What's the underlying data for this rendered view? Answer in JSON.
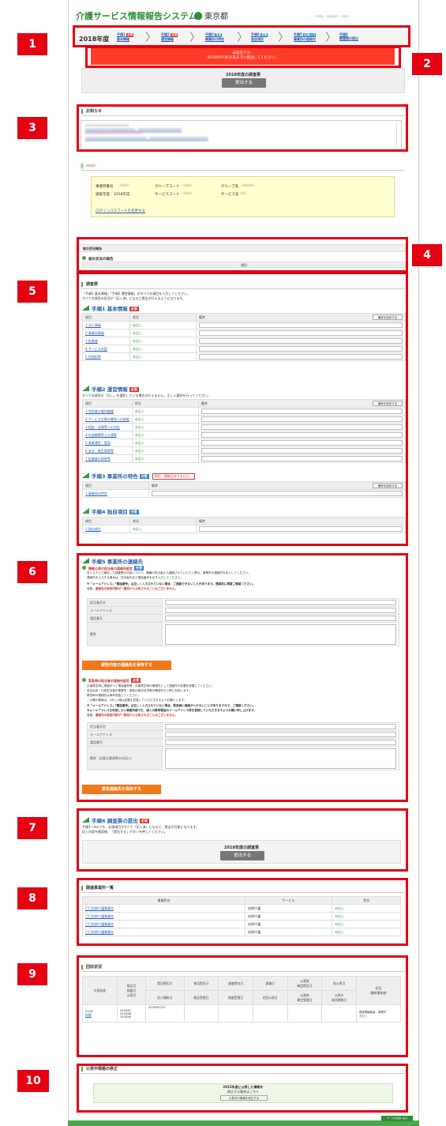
{
  "header": {
    "title": "介護サービス情報報告システム",
    "tokyo": "東京都"
  },
  "steps": {
    "year": "2018年度",
    "items": [
      {
        "line1": "手順1",
        "badge": "必須",
        "line2": "基本情報"
      },
      {
        "line1": "手順2",
        "badge": "必須",
        "line2": "運営情報"
      },
      {
        "line1": "手順3",
        "badge": "任意",
        "line2": "事業所の特色"
      },
      {
        "line1": "手順4",
        "badge": "任意",
        "line2": "独自項目"
      },
      {
        "line1": "手順5",
        "badge": "必須入力",
        "line2": "事業所の連絡先"
      },
      {
        "line1": "手順6",
        "badge": "",
        "line2": "調査票の提出"
      }
    ]
  },
  "alert": {
    "line1": "未提出です。",
    "line2": "2018年07月31日までに提出してください。"
  },
  "submit_top": {
    "title": "2018年度の調査票",
    "button": "提出する"
  },
  "notice": {
    "heading": "お知らせ"
  },
  "office_info": {
    "row1": [
      "事業所番号",
      "グループコード",
      "グループ名"
    ],
    "row2": [
      "調査年度：",
      "2018年度",
      "サービスコード",
      "サービス名"
    ],
    "password_link": "ログインパスワードを変更する"
  },
  "disaster": {
    "bar_label": "被災状況報告",
    "subheading": "被災状況の報告",
    "col_header": "項目",
    "link": "被災状況の報告"
  },
  "survey": {
    "heading": "調査票",
    "intro1": "「手順1 基本情報」「手順2 運営情報」のすべての項目を入力してください。",
    "intro2": "すべての項目の状況が「記入済」になると提出が行えるようになります。",
    "col_item": "項目",
    "col_status": "状況",
    "col_note": "備考",
    "save_note_btn": "備考を保存する",
    "step1": {
      "title": "手順1 基本情報",
      "badge": "必須",
      "rows": [
        {
          "item": "1.法人情報",
          "status": "未記入"
        },
        {
          "item": "2.事業所情報",
          "status": "未記入"
        },
        {
          "item": "3.従業者",
          "status": "未記入"
        },
        {
          "item": "4.サービス内容",
          "status": "未記入"
        },
        {
          "item": "5.利用料等",
          "status": "未記入"
        }
      ]
    },
    "step2": {
      "title": "手順2 運営情報",
      "badge": "必須",
      "intro": "すべての項目の「なし」を選択している場合は行えません。正しい選択を行ってください。",
      "rows": [
        {
          "item": "1.利用者の権利擁護",
          "status": "未記入"
        },
        {
          "item": "2.サービスの質の確保への取組",
          "status": "未記入"
        },
        {
          "item": "3.相談・苦情等への対応",
          "status": "未記入"
        },
        {
          "item": "4.外部機関等との連携",
          "status": "未記入"
        },
        {
          "item": "5.事業運営・管理",
          "status": "未記入"
        },
        {
          "item": "6.安全・衛生管理等",
          "status": "未記入"
        },
        {
          "item": "7.従業者の研修等",
          "status": "未記入"
        }
      ]
    },
    "step3": {
      "title": "手順3 事業所の特色",
      "badge": "任意",
      "warn": "現在、情報はありません。",
      "rows": [
        {
          "item": "1.事業所の特色"
        }
      ]
    },
    "step4": {
      "title": "手順4 独自項目",
      "badge": "任意",
      "rows": [
        {
          "item": "1.独自項目",
          "status": "未記入"
        }
      ]
    }
  },
  "contact": {
    "title": "手順5 事業所の連絡先",
    "sub1_title": "情報公表の担当者の連絡先設定",
    "sub1_badge": "任意",
    "sub1_desc1": "本システムで報告した調査票の内容について、管轄の担当者から連絡させていただく際の、事業所の連絡先を記入してください。",
    "sub1_desc2": "連絡先を入力する場合は、担当者氏名と電話番号を必ず入力してください。",
    "sub1_desc3": "※「メールアドレス」「電話番号」は正しく入力されていない場合、ご連絡できないことがあります。登録前に再度ご確認ください。",
    "sub1_desc4_prefix": "なお、",
    "sub1_desc4_red": "連絡先の設定内容が一般向けに公表されることはございません。",
    "fields": [
      "担当者氏名",
      "メールアドレス",
      "電話番号",
      "備考"
    ],
    "save1": "報告内容の連絡先を保存する",
    "sub2_title": "緊急時の担当者の連絡先設定",
    "sub2_badge": "必須",
    "sub2_desc1": "災害発生時に連絡がつく電話番号等、災害発生時の連絡先として連絡先が記載を記載してください。",
    "sub2_desc2": "各自治体・行政担当者が事業所・施設の被災状況等の確認を行う際に利用します。",
    "sub2_desc3": "緊急時の連絡先は毎年見直してください。",
    "sub2_desc4": "この欄の情報は、1年に1度は記載を見直していただきますようお願いします。",
    "sub2_desc5": "※「メールアドレス」「電話番号」は正しく入力されていない場合、緊急時に連絡がつかないことがありますので、ご確認ください。",
    "sub2_desc6": "※メールアドレスを利用しない事業所様でも、個人の携帯電話のメールアドレス等を登録していただきますようお願い申し上げます。",
    "sub2_desc7_prefix": "なお、",
    "sub2_desc7_red": "連絡先の設定内容が一般向けに公表されることはございません。",
    "fields2": [
      "担当者氏名",
      "メールアドレス",
      "電話番号",
      "備考（必要な事項等のみ記入）"
    ],
    "save2": "緊急連絡先を保存する"
  },
  "submit": {
    "title": "手順6 調査票の提出",
    "badge": "必須",
    "desc1": "手順1～4のうち、必須項目がすべて「記入済」になると、提出が可能になります。",
    "desc2": "記入内容を確認後、「提出する」ボタンを押してください。",
    "box_title": "2018年度の調査票",
    "button": "提出する"
  },
  "related": {
    "heading": "関連事業所一覧",
    "headers": [
      "事業所名",
      "サービス",
      "状況"
    ],
    "rows": [
      {
        "name": "〇〇訪問介護事業所",
        "service": "訪問介護",
        "status": "未記入"
      },
      {
        "name": "〇〇訪問介護事業所",
        "service": "訪問介護",
        "status": "未記入"
      },
      {
        "name": "〇〇訪問介護事業所",
        "service": "訪問介護",
        "status": "未記入"
      },
      {
        "name": "〇〇訪問介護事業所",
        "service": "訪問介護",
        "status": "未記入"
      }
    ]
  },
  "history": {
    "heading": "回収状況",
    "headers": [
      "計画年度",
      "報告月\n調査月\n公表月",
      "提出締切日",
      "報告提出日",
      "調査提出日",
      "調査日",
      "公表前\n確定提出日",
      "再公表日",
      "状況\n（最終更新者）"
    ],
    "subheaders": [
      "記入開始日",
      "報告受理日",
      "調査受理日",
      "初回公表日",
      "公表前\n確定受理日",
      "公表の\n取消期限日"
    ],
    "row": {
      "year": "2018",
      "year_link": "詳細",
      "months": "2018/07\n2018/08\n2018/09",
      "deadline": "2018/07/31",
      "status1": "調査票編集者：事業所",
      "status2": "未記入"
    }
  },
  "correction": {
    "heading": "公表中情報の修正",
    "title": "2015年度に公表した情報を",
    "sub": "修正する場合はこちら",
    "button": "公表中の情報を修正する"
  },
  "annotations": [
    "1",
    "2",
    "3",
    "4",
    "5",
    "6",
    "7",
    "8",
    "9",
    "10"
  ],
  "footer": {
    "button": "ページの先頭へ戻る"
  },
  "colors": {
    "accent_green": "#4aa84a",
    "alert_red": "#ff3c28",
    "annotation_red": "#e50012",
    "link_blue": "#2a5fb0",
    "orange": "#f07818"
  }
}
